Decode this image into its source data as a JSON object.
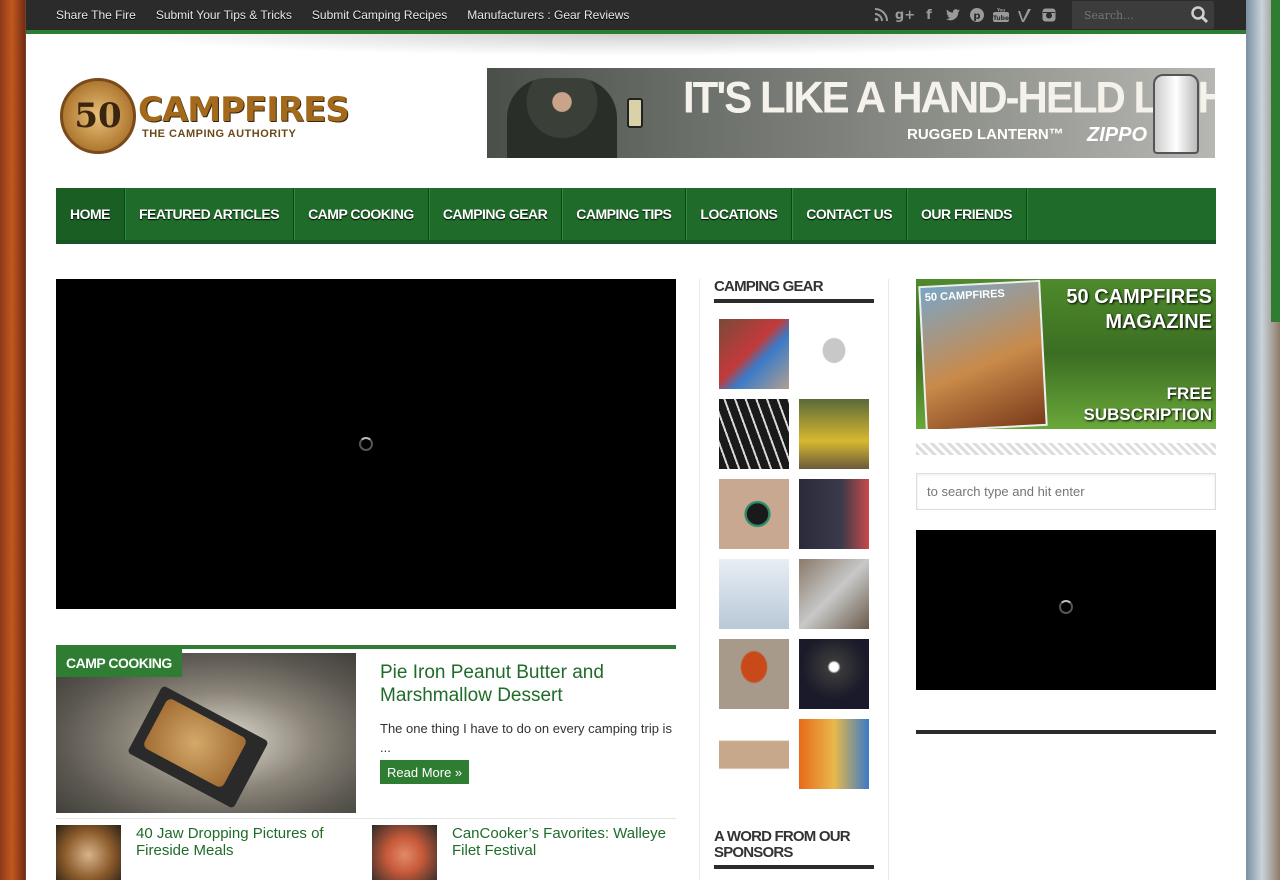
{
  "topbar": {
    "links": [
      "Share The Fire",
      "Submit Your Tips & Tricks",
      "Submit Camping Recipes",
      "Manufacturers : Gear Reviews"
    ],
    "social_icons": [
      "rss-icon",
      "google-plus-icon",
      "facebook-icon",
      "twitter-icon",
      "pinterest-icon",
      "youtube-icon",
      "vimeo-icon",
      "instagram-icon"
    ],
    "search_placeholder": "Search..."
  },
  "logo": {
    "number": "50",
    "name": "CAMPFIRES",
    "tagline": "THE CAMPING AUTHORITY"
  },
  "banner": {
    "headline": "IT'S LIKE A HAND-HELD LIGHTHOUSE.",
    "sub": "RUGGED LANTERN™",
    "brand": "ZIPPO"
  },
  "nav": {
    "items": [
      "HOME",
      "FEATURED ARTICLES",
      "CAMP COOKING",
      "CAMPING GEAR",
      "CAMPING TIPS",
      "LOCATIONS",
      "CONTACT US",
      "OUR FRIENDS"
    ],
    "active": "HOME"
  },
  "featured": {
    "category": "CAMP COOKING",
    "title": "Pie Iron Peanut Butter and Marshmallow Dessert",
    "excerpt": "The one thing I have to do on every camping trip is ...",
    "read_more": "Read More »"
  },
  "mini_posts": [
    {
      "title": "40 Jaw Dropping Pictures of Fireside Meals"
    },
    {
      "title": "CanCooker’s Favorites: Walleye Filet Festival"
    }
  ],
  "sidebar": {
    "gear_title": "CAMPING GEAR",
    "gear_thumbs": 12,
    "sponsors_title": "A WORD FROM OUR SPONSORS"
  },
  "magazine": {
    "line1": "50 CAMPFIRES MAGAZINE",
    "line2": "FREE SUBSCRIPTION",
    "cover_text": "50 CAMPFIRES"
  },
  "side_search": {
    "placeholder": "to search type and hit enter"
  },
  "colors": {
    "accent": "#2e7d32",
    "nav_bg": "#1f6b2a",
    "topbar": "#2b2b2b"
  }
}
